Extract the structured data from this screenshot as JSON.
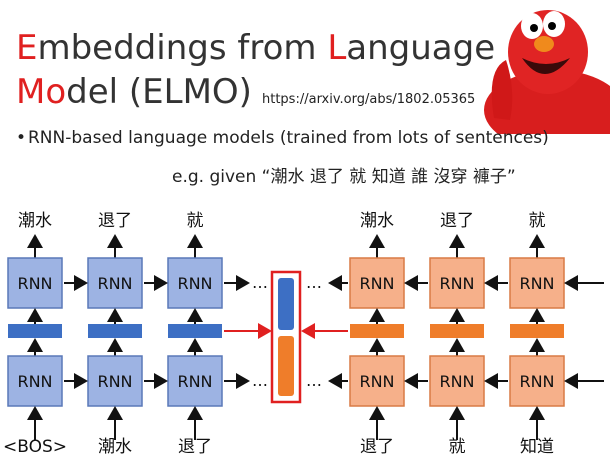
{
  "slide": {
    "title": {
      "line1_first": "E",
      "line1_rest_a": "mbeddings from ",
      "line1_hl_b": "L",
      "line1_rest_b": "anguage",
      "line2_hl": "Mo",
      "line2_rest": "del (ELMO)"
    },
    "url": "https://arxiv.org/abs/1802.05365",
    "bullet": "RNN-based language models (trained from lots of sentences)",
    "example": "e.g. given “潮水 退了 就 知道 誰 沒穿 褲子”"
  },
  "diagram": {
    "rnn_label": "RNN",
    "ellipsis": "…",
    "forward": {
      "outputs": [
        "潮水",
        "退了",
        "就"
      ],
      "inputs": [
        "<BOS>",
        "潮水",
        "退了"
      ]
    },
    "backward": {
      "outputs": [
        "潮水",
        "退了",
        "就"
      ],
      "inputs": [
        "退了",
        "就",
        "知道"
      ]
    },
    "colors": {
      "fwd_box": "#9db3e3",
      "fwd_border": "#5a78b8",
      "fwd_vec": "#3d6fc4",
      "bwd_box": "#f6b08a",
      "bwd_border": "#d97a45",
      "bwd_vec": "#ef7d2a",
      "accent": "#e02020"
    }
  }
}
